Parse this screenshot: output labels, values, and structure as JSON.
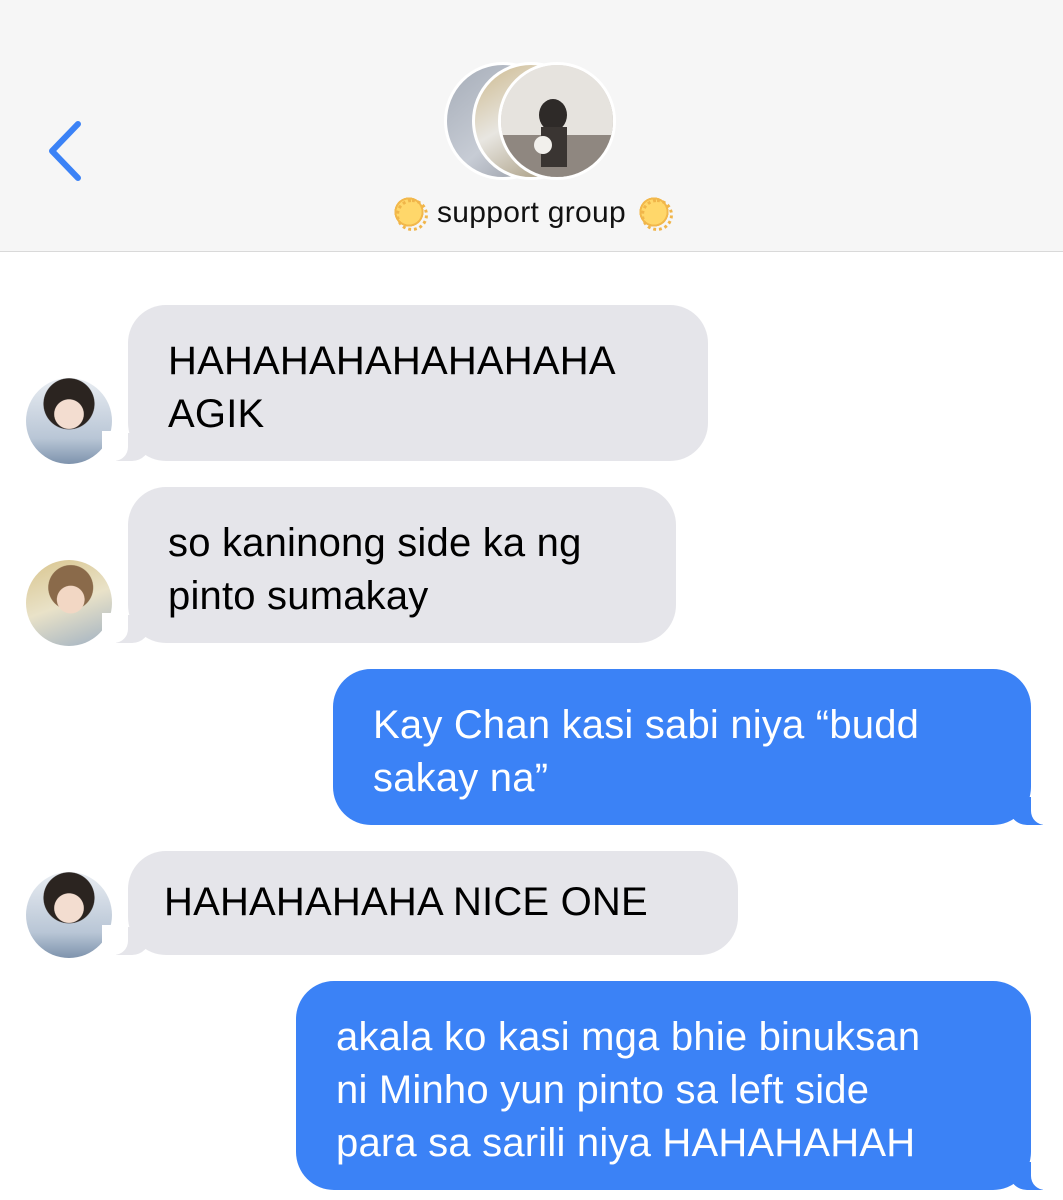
{
  "header": {
    "group_name": "support group",
    "title_emoji": "sun-with-face-icon",
    "back_icon": "chevron-left-icon",
    "accent_color": "#3b82f6"
  },
  "messages": [
    {
      "direction": "incoming",
      "sender_avatar": "avatar-member-1",
      "text": "HAHAHAHAHAHAHAHA\nAGIK"
    },
    {
      "direction": "incoming",
      "sender_avatar": "avatar-member-2",
      "text": "so kaninong side ka ng\npinto sumakay"
    },
    {
      "direction": "outgoing",
      "text": "Kay Chan kasi sabi niya “budd\nsakay na”"
    },
    {
      "direction": "incoming",
      "sender_avatar": "avatar-member-1",
      "text": "HAHAHAHAHA NICE ONE"
    },
    {
      "direction": "outgoing",
      "text": "akala ko kasi mga bhie binuksan\nni Minho yun pinto sa left side\npara sa sarili niya HAHAHAHAH"
    }
  ],
  "colors": {
    "incoming_bubble": "#e5e5ea",
    "outgoing_bubble": "#3b82f6",
    "header_bg": "#f6f6f6"
  }
}
